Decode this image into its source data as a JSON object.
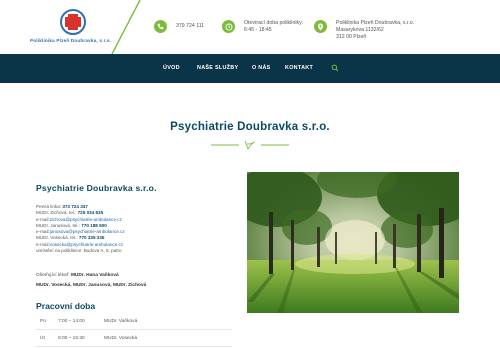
{
  "logo": {
    "name": "Poliklinika Plzeň Doubravka, s.r.o."
  },
  "header": {
    "phone": "379 724 111",
    "hours_label": "Otevírací doba polikliniky:",
    "hours_value": "6:45 - 18:45",
    "address_line1": "Poliklinika Plzeň Doubravka, s.r.o.",
    "address_line2": "Masarykova 1132/62",
    "address_line3": "312 00 Plzeň"
  },
  "nav": {
    "items": [
      "ÚVOD",
      "NAŠE SLUŽBY",
      "O NÁS",
      "KONTAKT"
    ]
  },
  "page": {
    "title": "Psychiatrie Doubravka s.r.o."
  },
  "content": {
    "heading": "Psychiatrie Doubravka s.r.o.",
    "contact": {
      "l1_label": "Pevná linka:",
      "l1_value": "373 724 347",
      "l2_label": "MUDr. Zichová, tel.:",
      "l2_value": "725 034 635",
      "l3_label": "e-mail:",
      "l3_value": "zichova@psychiatrie-ambulance.cz",
      "l4_label": "MUDr. Janusová, tel.:",
      "l4_value": "770 188 500",
      "l5_label": "e-mail:",
      "l5_value": "janusova@psychiatrie-ambulance.cz",
      "l6_label": "MUDr. Vosecká, tel.:",
      "l6_value": "770 335 335",
      "l7_label": "e-mail:",
      "l7_value": "vosecka@psychiatrie-ambulance.cz",
      "l8": "umístění na poliklinice: Budova A, 5. patro"
    },
    "doctors_label": "Ošetřující lékař:",
    "doctors_line1": "MUDr. Hana Vaňková",
    "doctors_line2": "MUDr. Vosecká, MUDr. Janusová, MUDr. Zichová",
    "hours_heading": "Pracovní doba",
    "hours": [
      {
        "day": "Po",
        "time": "7:00 – 14:00",
        "doctor": "MUDr. Vaňková"
      },
      {
        "day": "Út",
        "time": "8:00 – 15:30",
        "doctor": "MUDr. Vosecká"
      }
    ]
  },
  "colors": {
    "accent_green": "#7dbb3c",
    "nav_bg": "#0a3548",
    "heading": "#0a4a63"
  }
}
